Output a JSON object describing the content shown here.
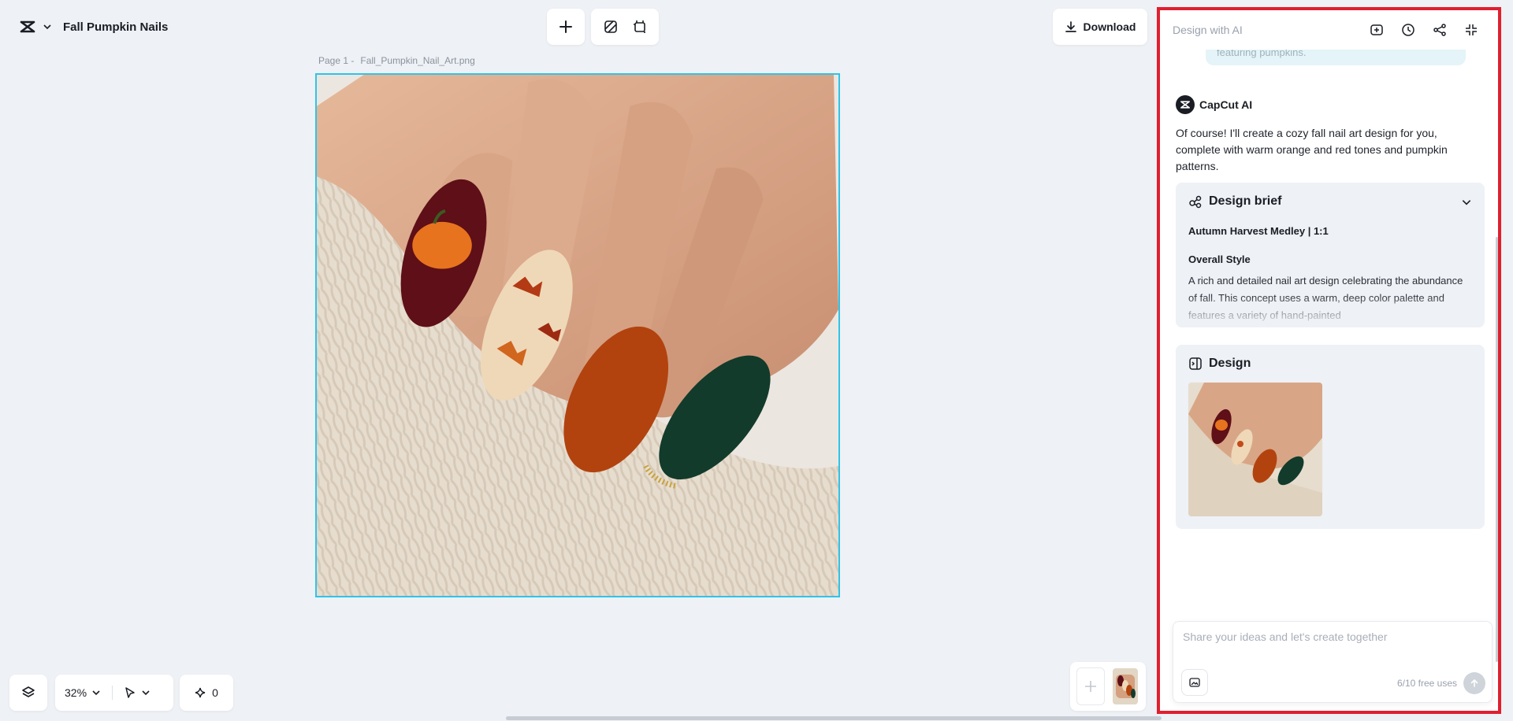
{
  "project": {
    "title": "Fall Pumpkin Nails"
  },
  "toolbar": {
    "download_label": "Download"
  },
  "canvas": {
    "page_label": "Page 1 -",
    "file_name": "Fall_Pumpkin_Nail_Art.png"
  },
  "bottom": {
    "zoom": "32%",
    "credits": "0"
  },
  "panel": {
    "title": "Design with AI",
    "prev_user_message": "featuring pumpkins.",
    "ai_name": "CapCut AI",
    "ai_message": "Of course! I'll create a cozy fall nail art design for you, complete with warm orange and red tones and pumpkin patterns.",
    "brief": {
      "title": "Design brief",
      "subtitle": "Autumn Harvest Medley | 1:1",
      "style_heading": "Overall Style",
      "description": "A rich and detailed nail art design celebrating the abundance of fall. This concept uses a warm, deep color palette and features a variety of hand-painted"
    },
    "design": {
      "title": "Design"
    },
    "input": {
      "placeholder": "Share your ideas and let's create together",
      "uses": "6/10 free uses"
    }
  },
  "colors": {
    "accent_border": "#2ec4e8",
    "panel_highlight": "#e01f2f"
  },
  "icons": [
    "capcut-logo-icon",
    "chevron-down-icon",
    "plus-icon",
    "remove-bg-icon",
    "resize-icon",
    "download-icon",
    "layers-icon",
    "select-pointer-icon",
    "sparkle-icon",
    "new-chat-icon",
    "history-icon",
    "share-icon",
    "collapse-icon",
    "design-brief-icon",
    "design-icon",
    "image-attach-icon",
    "send-arrow-icon"
  ]
}
